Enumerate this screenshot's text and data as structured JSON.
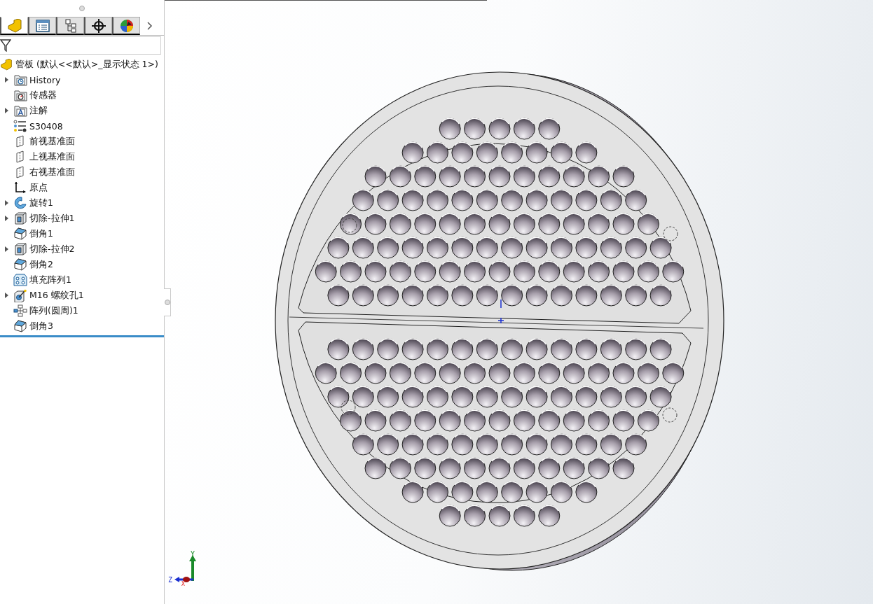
{
  "tabs": [
    {
      "kind": "feature",
      "selected": true
    },
    {
      "kind": "property",
      "selected": false
    },
    {
      "kind": "config",
      "selected": false
    },
    {
      "kind": "dimxpert",
      "selected": false
    },
    {
      "kind": "display",
      "selected": false
    }
  ],
  "tree": {
    "root": "管板  (默认<<默认>_显示状态 1>)",
    "items": [
      {
        "label": "History",
        "kind": "history",
        "collapsible": true
      },
      {
        "label": "传感器",
        "kind": "sensor",
        "collapsible": false
      },
      {
        "label": "注解",
        "kind": "annotation",
        "collapsible": true
      },
      {
        "label": "S30408",
        "kind": "material",
        "collapsible": false
      },
      {
        "label": "前视基准面",
        "kind": "plane",
        "collapsible": false
      },
      {
        "label": "上视基准面",
        "kind": "plane",
        "collapsible": false
      },
      {
        "label": "右视基准面",
        "kind": "plane",
        "collapsible": false
      },
      {
        "label": "原点",
        "kind": "origin",
        "collapsible": false
      },
      {
        "label": "旋转1",
        "kind": "revolve",
        "collapsible": true
      },
      {
        "label": "切除-拉伸1",
        "kind": "cut",
        "collapsible": true
      },
      {
        "label": "倒角1",
        "kind": "chamfer",
        "collapsible": false
      },
      {
        "label": "切除-拉伸2",
        "kind": "cut",
        "collapsible": true
      },
      {
        "label": "倒角2",
        "kind": "chamfer",
        "collapsible": false
      },
      {
        "label": "填充阵列1",
        "kind": "fill",
        "collapsible": false
      },
      {
        "label": "M16 螺纹孔1",
        "kind": "hole",
        "collapsible": true
      },
      {
        "label": "阵列(圆周)1",
        "kind": "pattern",
        "collapsible": false
      },
      {
        "label": "倒角3",
        "kind": "chamfer",
        "collapsible": false
      }
    ]
  },
  "triad": {
    "y": "Y",
    "z": "Z",
    "x": "X"
  }
}
